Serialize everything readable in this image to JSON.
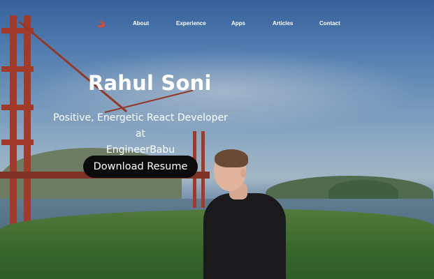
{
  "nav": {
    "logo_icon": "swift-bird-icon",
    "items": [
      "About",
      "Experience",
      "Apps",
      "Articles",
      "Contact"
    ]
  },
  "hero": {
    "name": "Rahul Soni",
    "tagline_line1": "Positive, Energetic React Developer at",
    "tagline_line2": "EngineerBabu",
    "resume_button": "Download Resume"
  },
  "colors": {
    "accent": "#e8452c",
    "button_bg": "#0b0b0b",
    "text": "#ffffff"
  }
}
